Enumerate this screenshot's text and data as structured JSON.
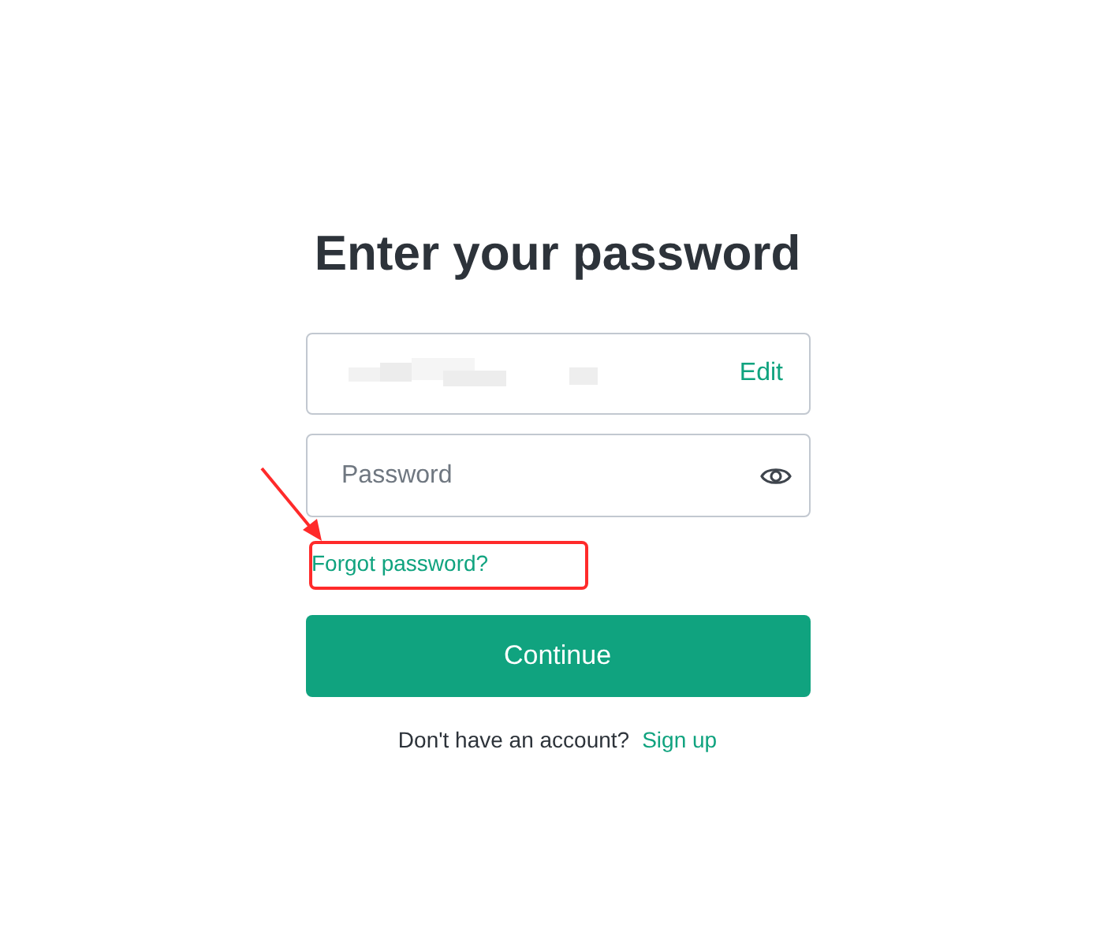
{
  "title": "Enter your password",
  "email_field": {
    "action": "Edit"
  },
  "password_field": {
    "placeholder": "Password"
  },
  "forgot_link": "Forgot password?",
  "continue_button": "Continue",
  "footer": {
    "prompt": "Don't have an account?",
    "link": "Sign up"
  }
}
